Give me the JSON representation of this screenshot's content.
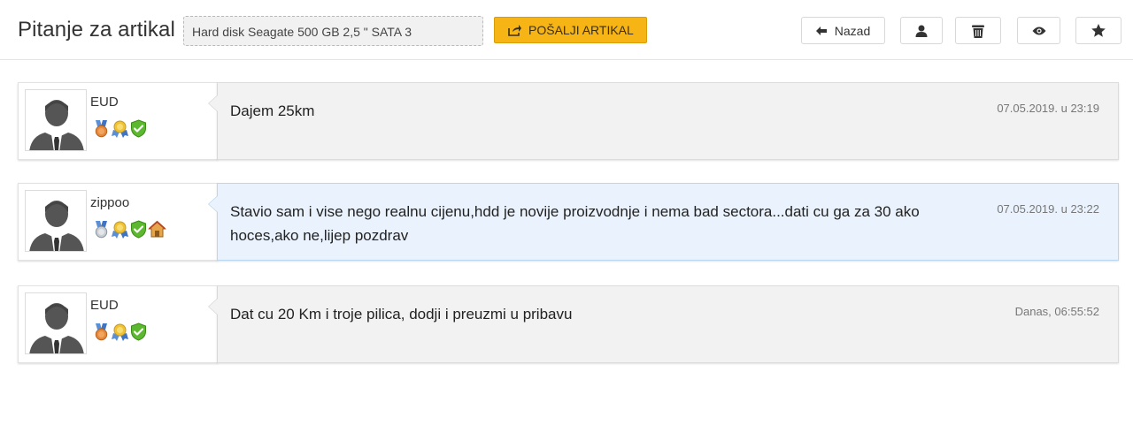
{
  "header": {
    "title": "Pitanje za artikal",
    "article": "Hard disk Seagate 500 GB 2,5 \" SATA 3",
    "send_label": "POŠALJI ARTIKAL",
    "back_label": "Nazad",
    "icons": [
      "share-icon",
      "arrow-left-icon",
      "user-icon",
      "trash-icon",
      "eye-icon",
      "star-icon"
    ]
  },
  "messages": [
    {
      "user": "EUD",
      "badges": [
        "medal-bronze-icon",
        "award-ribbon-icon",
        "verified-shield-icon"
      ],
      "text": "Dajem 25km",
      "time": "07.05.2019. u 23:19",
      "highlighted": false
    },
    {
      "user": "zippoo",
      "badges": [
        "medal-silver-icon",
        "award-ribbon-icon",
        "verified-shield-icon",
        "house-icon"
      ],
      "text": "Stavio sam i vise nego realnu cijenu,hdd je novije proizvodnje i nema bad sectora...dati cu ga za 30 ako hoces,ako ne,lijep pozdrav",
      "time": "07.05.2019. u 23:22",
      "highlighted": true
    },
    {
      "user": "EUD",
      "badges": [
        "medal-bronze-icon",
        "award-ribbon-icon",
        "verified-shield-icon"
      ],
      "text": "Dat cu 20 Km i troje pilica, dodji i preuzmi u pribavu",
      "time": "Danas, 06:55:52",
      "highlighted": false
    }
  ],
  "colors": {
    "accent": "#f7b515",
    "highlight_bg": "#eaf3fd",
    "message_bg": "#f2f2f2"
  }
}
